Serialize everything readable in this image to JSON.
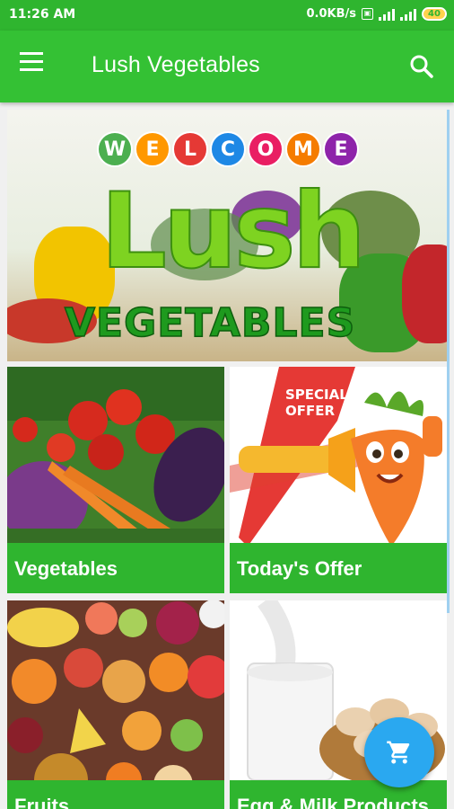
{
  "status_bar": {
    "time": "11:26 AM",
    "network_speed": "0.0KB/s",
    "battery": "40"
  },
  "app_bar": {
    "title": "Lush Vegetables"
  },
  "banner": {
    "welcome_letters": [
      "W",
      "E",
      "L",
      "C",
      "O",
      "M",
      "E"
    ],
    "brand_word": "Lush",
    "sub_word": "VEGETABLES"
  },
  "tiles": [
    {
      "label": "Vegetables"
    },
    {
      "label": "Today's Offer",
      "badge": "SPECIAL OFFER"
    },
    {
      "label": "Fruits"
    },
    {
      "label": "Egg & Milk Products"
    }
  ],
  "colors": {
    "primary": "#34c134",
    "status_bar": "#2fb52f",
    "fab": "#2aa8f0"
  },
  "icons": {
    "menu": "hamburger-menu-icon",
    "search": "search-icon",
    "cart": "shopping-cart-icon"
  }
}
